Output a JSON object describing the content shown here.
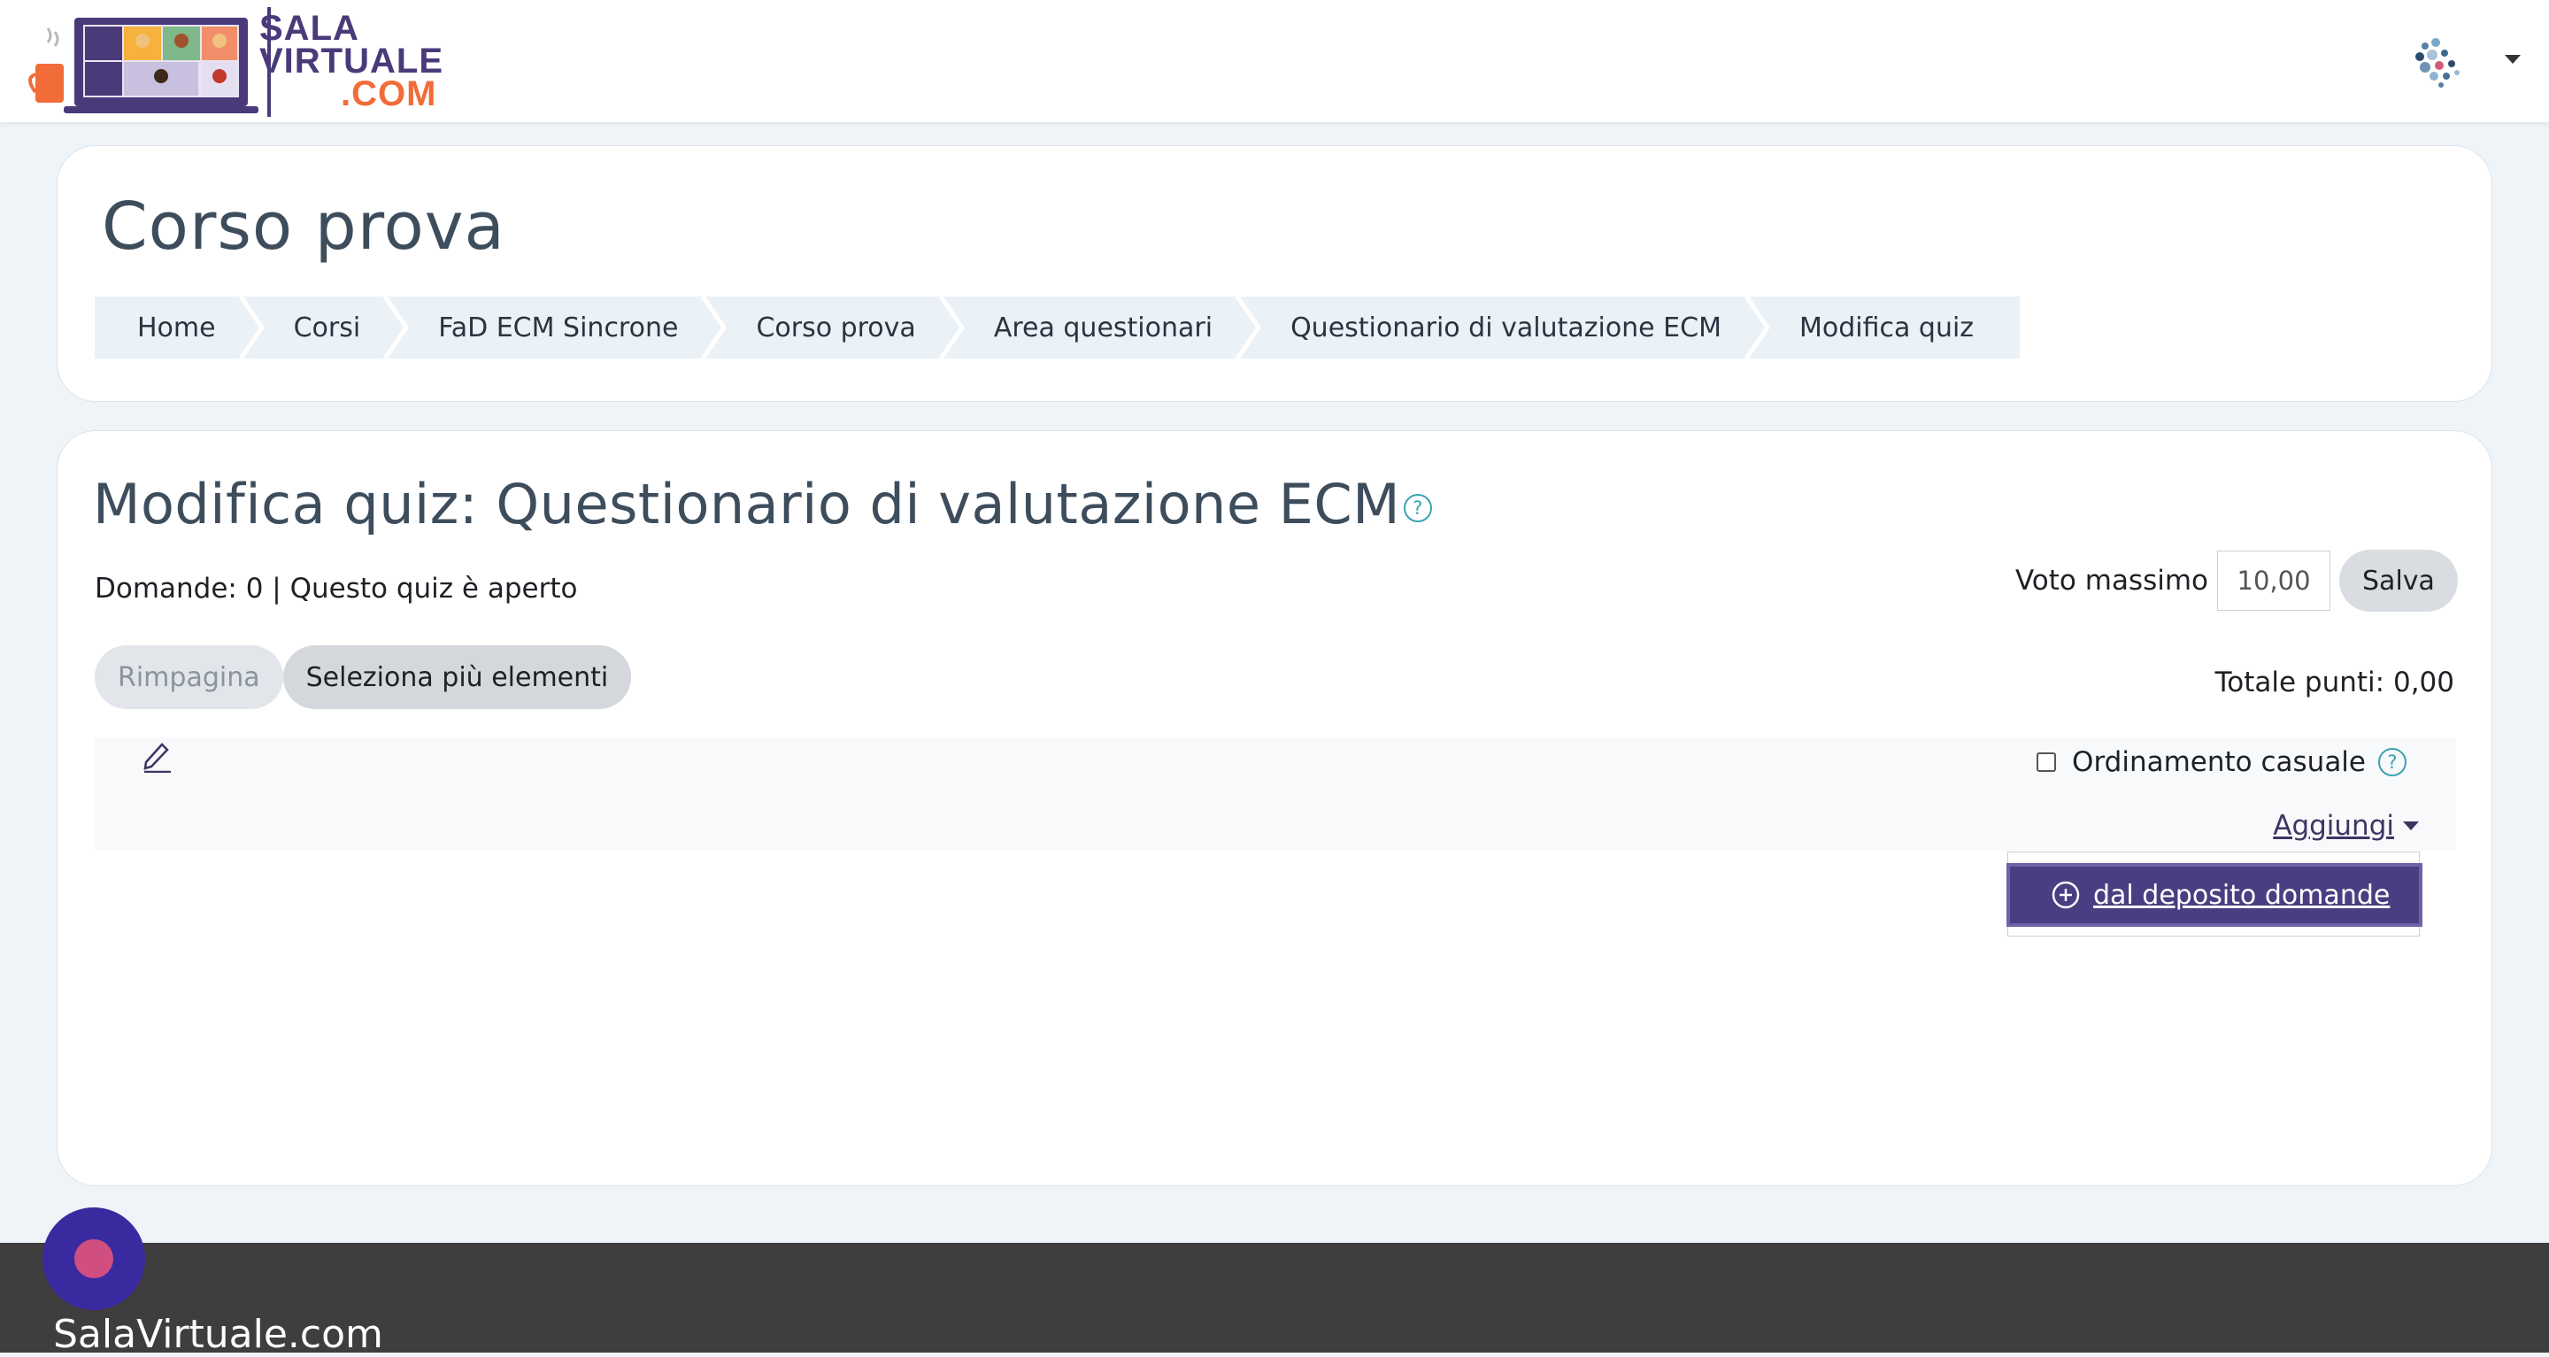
{
  "brand": {
    "logo_line1": "SALA",
    "logo_line2": "VIRTUALE",
    "logo_line3": ".COM"
  },
  "header": {
    "course_title": "Corso prova",
    "breadcrumb": [
      {
        "label": "Home"
      },
      {
        "label": "Corsi"
      },
      {
        "label": "FaD ECM Sincrone"
      },
      {
        "label": "Corso prova"
      },
      {
        "label": "Area questionari"
      },
      {
        "label": "Questionario di valutazione ECM"
      },
      {
        "label": "Modifica quiz"
      }
    ]
  },
  "quiz": {
    "title": "Modifica quiz: Questionario di valutazione ECM",
    "help_glyph": "?",
    "status": "Domande: 0 | Questo quiz è aperto",
    "max_grade_label": "Voto massimo",
    "max_grade_value": "10,00",
    "save_label": "Salva",
    "repaginate_label": "Rimpagina",
    "select_multiple_label": "Seleziona più elementi",
    "total_points": "Totale punti: 0,00",
    "shuffle_label": "Ordinamento casuale",
    "add_label": "Aggiungi",
    "add_menu": {
      "from_bank_label": "dal deposito domande"
    }
  },
  "footer": {
    "site_name": "SalaVirtuale.com"
  },
  "colors": {
    "brand_purple": "#4a3a7a",
    "brand_orange": "#f26c3a",
    "dropdown_active": "#4b3d82",
    "footer_bg": "#403d3f",
    "page_bg": "#eff4f8"
  }
}
